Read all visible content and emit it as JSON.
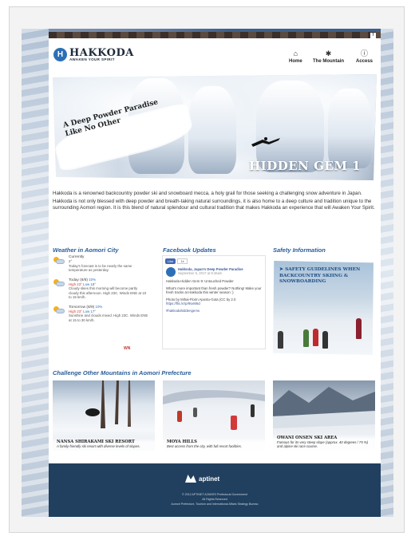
{
  "header": {
    "logo_mark": "H",
    "logo_title": "HAKKODA",
    "logo_subtitle": "AWAKEN YOUR SPIRIT",
    "nav": [
      {
        "label": "Home",
        "icon": "home-icon",
        "glyph": "⌂"
      },
      {
        "label": "The Mountain",
        "icon": "snowflake-icon",
        "glyph": "✱"
      },
      {
        "label": "Access",
        "icon": "info-icon",
        "glyph": "ⓘ"
      }
    ],
    "facebook_glyph": "f"
  },
  "hero": {
    "tagline": "A Deep Powder Paradise Like No Other",
    "title": "HIDDEN GEM 1"
  },
  "intro": {
    "p1": "Hakkoda is a renowned backcountry powder ski and snowboard mecca, a holy grail for those seeking a challenging snow adventure in Japan.",
    "p2": "Hakkoda is not only blessed with deep powder and breath-taking natural surroundings, it is also home to a deep culture and tradition unique to the surrounding Aomori region. It is this blend of natural splendour and cultural tradition that makes Hakkoda an experience that will Awaken Your Spirit."
  },
  "weather": {
    "title": "Weather in Aomori City",
    "items": [
      {
        "day": "Currently",
        "temp": "2°",
        "rain": "",
        "desc": "Today's forecast is to be nearly the same temperature as yesterday."
      },
      {
        "day": "Today (8/8)",
        "high": "High 23°",
        "low": "Low 18°",
        "rain": "10%",
        "desc": "Cloudy skies this morning will become partly cloudy this afternoon. High 23C. Winds ENE at 10 to 15 km/h."
      },
      {
        "day": "Tomorrow (8/9)",
        "high": "High 23°",
        "low": "Low 17°",
        "rain": "10%",
        "desc": "Sunshine and clouds mixed. High 23C. Winds ENE at 15 to 30 km/h."
      }
    ],
    "provider": "WN"
  },
  "facebook": {
    "title": "Facebook Updates",
    "like_label": "Like",
    "like_count": "1k",
    "post_name": "Hakkoda, Japan's Deep Powder Paradise",
    "post_date": "September 5, 2017 at 8:46am",
    "post_lines": [
      "Hakkoda Hidden Gem 9: Untouched Powder",
      "What's more important than fresh powder? Nothing! Make your fresh tracks at Hakkoda this winter season :)",
      "Photo by Mihai-Florin Apostu-Gota (CC by 2.0",
      "#hakkodahiddengems"
    ],
    "post_link": "https://flic.kr/p/9sxM6d"
  },
  "safety": {
    "title": "Safety Information",
    "banner": "Safety guidelines when backcountry skiing & snowboarding"
  },
  "mountains": {
    "title": "Challenge Other Mountains in Aomori Prefecture",
    "cards": [
      {
        "name": "NANSA SHIRAKAMI SKI RESORT",
        "desc": "A family-friendly ski resort with diverse levels of slopes."
      },
      {
        "name": "MOYA HILLS",
        "desc": "Best access from the city, with full resort facilities."
      },
      {
        "name": "OWANI ONSEN SKI AREA",
        "desc": "Famous for its very steep slope (approx. 40 degrees / 75 %) and alpine ski race course."
      }
    ]
  },
  "footer": {
    "brand": "aptinet",
    "copyright": "© 2012 APTINET AOMORI Prefectural Government",
    "rights": "All Rights Reserved",
    "dept": "Aomori Prefecture, Tourism and International Affairs Strategy Bureau"
  },
  "colors": {
    "accent": "#2a5d9a",
    "footer": "#21405f",
    "high_temp": "#d4372f"
  }
}
